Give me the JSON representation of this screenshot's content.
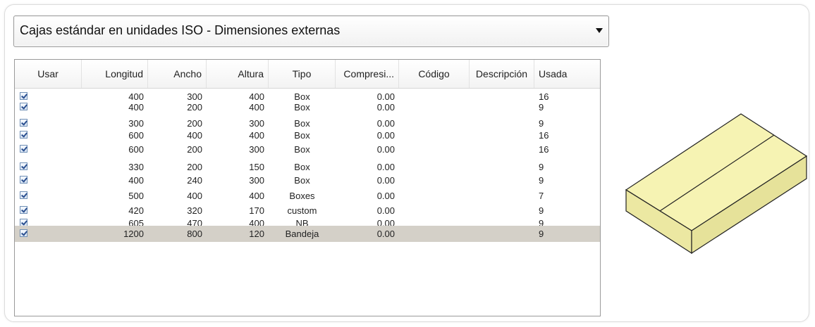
{
  "dropdown": {
    "selected": "Cajas estándar en unidades ISO - Dimensiones externas"
  },
  "table": {
    "columns": [
      "Usar",
      "Longitud",
      "Ancho",
      "Altura",
      "Tipo",
      "Compresi...",
      "Código",
      "Descripción",
      "Usada"
    ],
    "rows": [
      {
        "usar": true,
        "longitud": "400",
        "ancho": "300",
        "altura": "400",
        "tipo": "Box",
        "compresion": "0.00",
        "codigo": "",
        "descripcion": "",
        "usada": "16"
      },
      {
        "usar": true,
        "longitud": "400",
        "ancho": "200",
        "altura": "400",
        "tipo": "Box",
        "compresion": "0.00",
        "codigo": "",
        "descripcion": "",
        "usada": "9"
      },
      {
        "usar": true,
        "longitud": "300",
        "ancho": "200",
        "altura": "300",
        "tipo": "Box",
        "compresion": "0.00",
        "codigo": "",
        "descripcion": "",
        "usada": "9"
      },
      {
        "usar": true,
        "longitud": "600",
        "ancho": "400",
        "altura": "400",
        "tipo": "Box",
        "compresion": "0.00",
        "codigo": "",
        "descripcion": "",
        "usada": "16"
      },
      {
        "usar": true,
        "longitud": "600",
        "ancho": "200",
        "altura": "300",
        "tipo": "Box",
        "compresion": "0.00",
        "codigo": "",
        "descripcion": "",
        "usada": "16"
      },
      {
        "usar": true,
        "longitud": "330",
        "ancho": "200",
        "altura": "150",
        "tipo": "Box",
        "compresion": "0.00",
        "codigo": "",
        "descripcion": "",
        "usada": "9"
      },
      {
        "usar": true,
        "longitud": "400",
        "ancho": "240",
        "altura": "300",
        "tipo": "Box",
        "compresion": "0.00",
        "codigo": "",
        "descripcion": "",
        "usada": "9"
      },
      {
        "usar": true,
        "longitud": "500",
        "ancho": "400",
        "altura": "400",
        "tipo": "Boxes",
        "compresion": "0.00",
        "codigo": "",
        "descripcion": "",
        "usada": "7"
      },
      {
        "usar": true,
        "longitud": "420",
        "ancho": "320",
        "altura": "170",
        "tipo": "custom",
        "compresion": "0.00",
        "codigo": "",
        "descripcion": "",
        "usada": "9"
      },
      {
        "usar": true,
        "longitud": "605",
        "ancho": "470",
        "altura": "400",
        "tipo": "NB",
        "compresion": "0.00",
        "codigo": "",
        "descripcion": "",
        "usada": "9"
      },
      {
        "usar": true,
        "longitud": "1200",
        "ancho": "800",
        "altura": "120",
        "tipo": "Bandeja",
        "compresion": "0.00",
        "codigo": "",
        "descripcion": "",
        "usada": "9",
        "selected": true
      }
    ]
  },
  "preview": {
    "icon": "box-3d-preview-icon",
    "colors": {
      "top": "#f6f3b3",
      "left": "#ece8a2",
      "right": "#e6e29a",
      "stroke": "#222222"
    }
  }
}
